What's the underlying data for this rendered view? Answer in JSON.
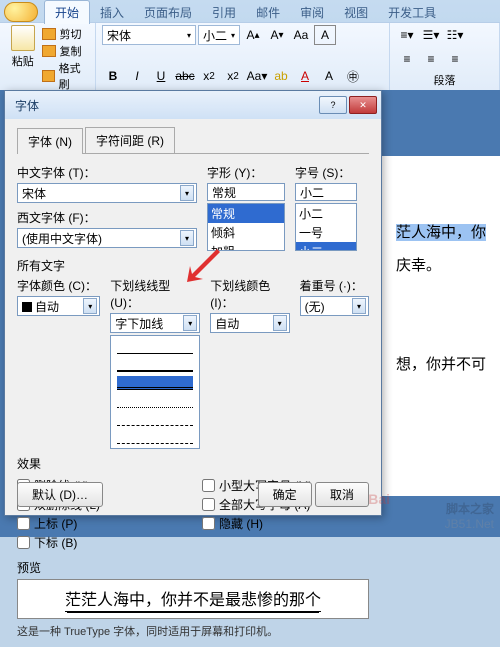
{
  "ribbon": {
    "tabs": [
      "开始",
      "插入",
      "页面布局",
      "引用",
      "邮件",
      "审阅",
      "视图",
      "开发工具"
    ],
    "active_tab": "开始",
    "paste": "粘贴",
    "cut": "剪切",
    "copy": "复制",
    "format_painter": "格式刷",
    "font_name": "宋体",
    "font_size": "小二",
    "para_label": "段落"
  },
  "doc": {
    "line1_hl": "茫人海中，你",
    "line2": "庆幸。",
    "line3": "想，你并不可"
  },
  "dialog": {
    "title": "字体",
    "tabs": [
      "字体 (N)",
      "字符间距 (R)"
    ],
    "cn_font_label": "中文字体 (T)：",
    "cn_font_value": "宋体",
    "wn_font_label": "西文字体 (F)：",
    "wn_font_value": "(使用中文字体)",
    "style_label": "字形 (Y)：",
    "style_value": "常规",
    "style_options": [
      "常规",
      "倾斜",
      "加粗"
    ],
    "size_label": "字号 (S)：",
    "size_value": "小二",
    "size_options": [
      "小二",
      "一号",
      "小二"
    ],
    "all_text": "所有文字",
    "font_color_label": "字体颜色 (C)：",
    "font_color_value": "自动",
    "underline_label": "下划线线型 (U)：",
    "underline_sel": "字下加线",
    "underline_color_label": "下划线颜色 (I)：",
    "underline_color_value": "自动",
    "emphasis_label": "着重号 (·)：",
    "emphasis_value": "(无)",
    "effects_label": "效果",
    "effects_left": [
      "删除线 (K)",
      "双删除线 (L)",
      "上标 (P)",
      "下标 (B)"
    ],
    "effects_right": [
      "小型大写字母 (M)",
      "全部大写字母 (A)",
      "隐藏 (H)"
    ],
    "preview_label": "预览",
    "preview_text": "茫茫人海中，你并不是最悲惨的那个",
    "note": "这是一种 TrueType 字体，同时适用于屏幕和打印机。",
    "default_btn": "默认 (D)…",
    "ok": "确定",
    "cancel": "取消"
  },
  "watermark": {
    "line1": "脚本之家",
    "line2": "JB51.Net"
  },
  "baidu": "Bai"
}
